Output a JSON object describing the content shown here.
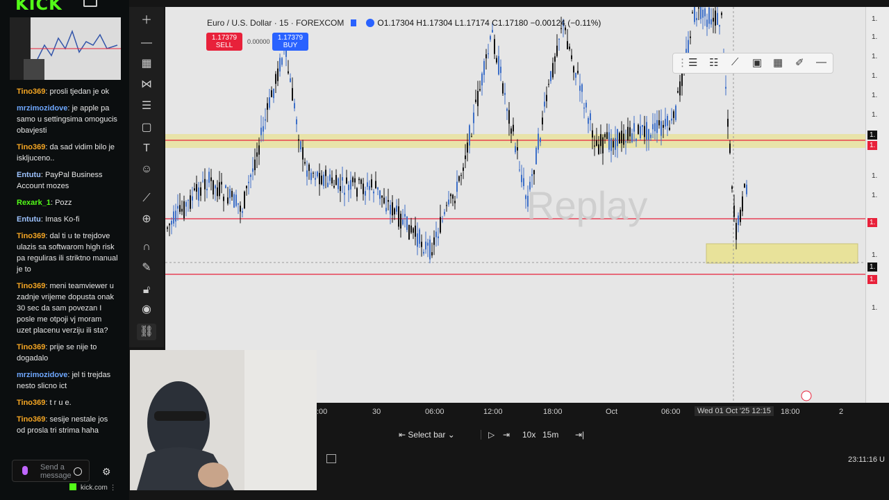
{
  "kick": {
    "logo": "KICK",
    "chat": [
      {
        "user": "Tino369",
        "color": "#f5a623",
        "text": "prosli tjedan je ok"
      },
      {
        "user": "mrzimozidove",
        "color": "#6fa8ff",
        "text": "je apple pa samo u settingsima omogucis obavjesti"
      },
      {
        "user": "Tino369",
        "color": "#f5a623",
        "text": "da sad vidim bilo je iskljuceno.."
      },
      {
        "user": "Entutu",
        "color": "#9ec3ff",
        "text": "PayPal Business Account mozes"
      },
      {
        "user": "Rexark_1",
        "color": "#53fc18",
        "text": "Pozz"
      },
      {
        "user": "Entutu",
        "color": "#9ec3ff",
        "text": "Imas Ko-fi"
      },
      {
        "user": "Tino369",
        "color": "#f5a623",
        "text": "dal ti u te trejdove ulazis sa softwarom high risk pa reguliras ili striktno manual je to"
      },
      {
        "user": "Tino369",
        "color": "#f5a623",
        "text": "meni teamviewer u zadnje vrijeme dopusta onak 30 sec da sam povezan I posle me otpoji vj moram uzet placenu verziju ili sta?"
      },
      {
        "user": "Tino369",
        "color": "#f5a623",
        "text": "prije se nije to dogadalo"
      },
      {
        "user": "mrzimozidove",
        "color": "#6fa8ff",
        "text": "jel ti trejdas nesto slicno ict"
      },
      {
        "user": "Tino369",
        "color": "#f5a623",
        "text": "t r u e."
      },
      {
        "user": "Tino369",
        "color": "#f5a623",
        "text": "sesije nestale jos od prosla tri strima haha"
      }
    ],
    "chat_placeholder": "Send a message",
    "footer": "kick.com"
  },
  "chart": {
    "symbol": "Euro / U.S. Dollar · 15 · FOREXCOM",
    "ohlc": "O1.17304 H1.17304 L1.17174 C1.17180 −0.00124 (−0.11%)",
    "sell_price": "1.17379",
    "sell_label": "SELL",
    "buy_price": "1.17379",
    "buy_label": "BUY",
    "spread": "0.00000",
    "watermark": "Replay"
  },
  "price_axis": [
    "1.",
    "1.",
    "1.",
    "1.",
    "1.",
    "1.",
    "1.",
    "1.",
    "1.",
    "1.",
    "1.",
    "1.",
    "1.",
    "1.",
    "1."
  ],
  "time_axis": [
    {
      "label": ":00"
    },
    {
      "label": "30"
    },
    {
      "label": "06:00"
    },
    {
      "label": "12:00"
    },
    {
      "label": "18:00"
    },
    {
      "label": "Oct"
    },
    {
      "label": "06:00"
    },
    {
      "label": "Wed 01 Oct '25   12:15"
    },
    {
      "label": "18:00"
    },
    {
      "label": "2"
    }
  ],
  "replay": {
    "select_bar": "Select bar",
    "speed": "10x",
    "interval": "15m"
  },
  "clock": "23:11:16 U",
  "colors": {
    "red_line": "#e8213a",
    "zone": "#e8e29a",
    "bull": "#3d6fc8",
    "bear": "#111111"
  }
}
